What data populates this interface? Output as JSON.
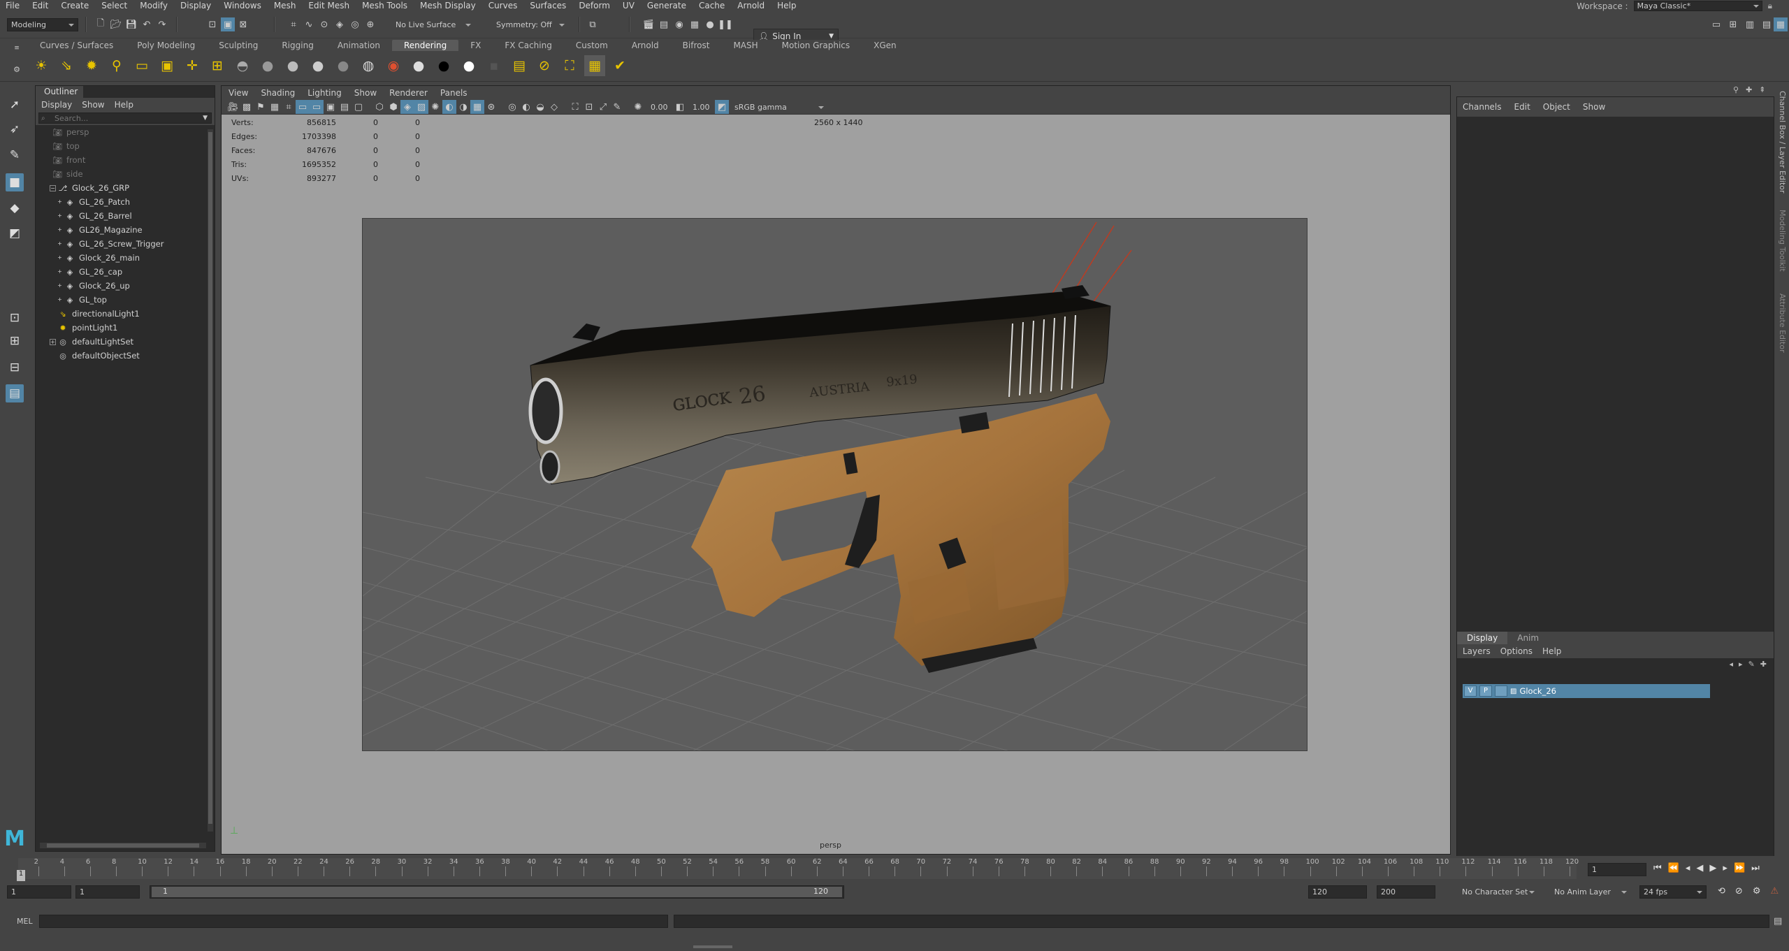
{
  "menubar": {
    "items": [
      "File",
      "Edit",
      "Create",
      "Select",
      "Modify",
      "Display",
      "Windows",
      "Mesh",
      "Edit Mesh",
      "Mesh Tools",
      "Mesh Display",
      "Curves",
      "Surfaces",
      "Deform",
      "UV",
      "Generate",
      "Cache",
      "Arnold",
      "Help"
    ],
    "workspace_label": "Workspace :",
    "workspace_value": "Maya Classic*"
  },
  "statusline": {
    "mode": "Modeling",
    "live_surface": "No Live Surface",
    "symmetry": "Symmetry: Off",
    "sign_in": "Sign In"
  },
  "shelf": {
    "tabs": [
      "Curves / Surfaces",
      "Poly Modeling",
      "Sculpting",
      "Rigging",
      "Animation",
      "Rendering",
      "FX",
      "FX Caching",
      "Custom",
      "Arnold",
      "Bifrost",
      "MASH",
      "Motion Graphics",
      "XGen"
    ],
    "active_tab": "Rendering"
  },
  "outliner": {
    "title": "Outliner",
    "menus": [
      "Display",
      "Show",
      "Help"
    ],
    "search_placeholder": "Search...",
    "items": [
      {
        "label": "persp",
        "dim": true
      },
      {
        "label": "top",
        "dim": true
      },
      {
        "label": "front",
        "dim": true
      },
      {
        "label": "side",
        "dim": true
      },
      {
        "label": "Glock_26_GRP"
      },
      {
        "label": "GL_26_Patch"
      },
      {
        "label": "GL_26_Barrel"
      },
      {
        "label": "GL26_Magazine"
      },
      {
        "label": "GL_26_Screw_Trigger"
      },
      {
        "label": "Glock_26_main"
      },
      {
        "label": "GL_26_cap"
      },
      {
        "label": "Glock_26_up"
      },
      {
        "label": "GL_top"
      },
      {
        "label": "directionalLight1"
      },
      {
        "label": "pointLight1"
      },
      {
        "label": "defaultLightSet"
      },
      {
        "label": "defaultObjectSet"
      }
    ]
  },
  "viewport": {
    "menus": [
      "View",
      "Shading",
      "Lighting",
      "Show",
      "Renderer",
      "Panels"
    ],
    "exposure": "0.00",
    "gamma": "1.00",
    "color_space": "sRGB gamma",
    "resolution": "2560 x 1440",
    "camera": "persp",
    "hud": [
      {
        "label": "Verts:",
        "v1": "856815",
        "v2": "0",
        "v3": "0"
      },
      {
        "label": "Edges:",
        "v1": "1703398",
        "v2": "0",
        "v3": "0"
      },
      {
        "label": "Faces:",
        "v1": "847676",
        "v2": "0",
        "v3": "0"
      },
      {
        "label": "Tris:",
        "v1": "1695352",
        "v2": "0",
        "v3": "0"
      },
      {
        "label": "UVs:",
        "v1": "893277",
        "v2": "0",
        "v3": "0"
      }
    ],
    "slide_engraving": {
      "logo": "GLOCK",
      "model": "26",
      "country": "AUSTRIA",
      "caliber": "9x19"
    }
  },
  "channelbox": {
    "menus": [
      "Channels",
      "Edit",
      "Object",
      "Show"
    ],
    "side_tabs": [
      "Channel Box / Layer Editor",
      "Modeling Toolkit",
      "Attribute Editor"
    ]
  },
  "layer_editor": {
    "tabs": [
      "Display",
      "Anim"
    ],
    "active_tab": "Display",
    "menus": [
      "Layers",
      "Options",
      "Help"
    ],
    "layer": {
      "v": "V",
      "p": "P",
      "name": "Glock_26"
    }
  },
  "timeslider": {
    "ticks": [
      "2",
      "4",
      "6",
      "8",
      "10",
      "12",
      "14",
      "16",
      "18",
      "20",
      "22",
      "24",
      "26",
      "28",
      "30",
      "32",
      "34",
      "36",
      "38",
      "40",
      "42",
      "44",
      "46",
      "48",
      "50",
      "52",
      "54",
      "56",
      "58",
      "60",
      "62",
      "64",
      "66",
      "68",
      "70",
      "72",
      "74",
      "76",
      "78",
      "80",
      "82",
      "84",
      "86",
      "88",
      "90",
      "92",
      "94",
      "96",
      "98",
      "100",
      "102",
      "104",
      "106",
      "108",
      "110",
      "112",
      "114",
      "116",
      "118",
      "120"
    ],
    "current_frame_marker": "1",
    "current_frame": "1"
  },
  "rangeslider": {
    "start": "1",
    "playback_start": "1",
    "range_start": "1",
    "range_end": "120",
    "playback_end": "120",
    "end": "200",
    "character_set": "No Character Set",
    "anim_layer": "No Anim Layer",
    "fps": "24 fps"
  },
  "cmdline": {
    "label": "MEL"
  }
}
